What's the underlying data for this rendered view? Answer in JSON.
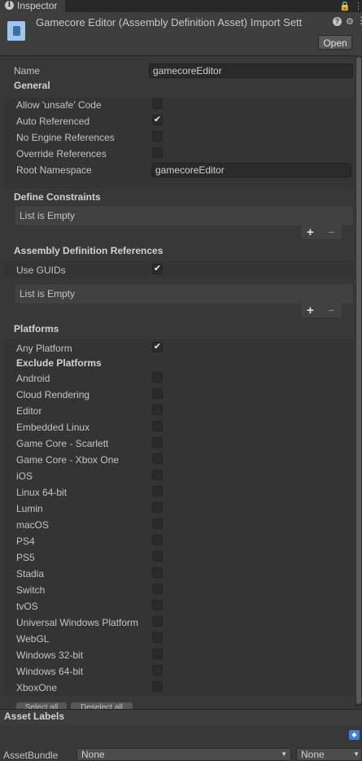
{
  "tab": {
    "label": "Inspector"
  },
  "header": {
    "title": "Gamecore Editor (Assembly Definition Asset) Import Sett",
    "open_label": "Open"
  },
  "name": {
    "label": "Name",
    "value": "gamecoreEditor"
  },
  "general": {
    "heading": "General",
    "allow_unsafe": {
      "label": "Allow 'unsafe' Code",
      "checked": false
    },
    "auto_referenced": {
      "label": "Auto Referenced",
      "checked": true
    },
    "no_engine_refs": {
      "label": "No Engine References",
      "checked": false
    },
    "override_refs": {
      "label": "Override References",
      "checked": false
    },
    "root_namespace": {
      "label": "Root Namespace",
      "value": "gamecoreEditor"
    }
  },
  "define_constraints": {
    "heading": "Define Constraints",
    "empty_text": "List is Empty",
    "add": "+",
    "remove": "−"
  },
  "assembly_refs": {
    "heading": "Assembly Definition References",
    "use_guids": {
      "label": "Use GUIDs",
      "checked": true
    },
    "empty_text": "List is Empty",
    "add": "+",
    "remove": "−"
  },
  "platforms": {
    "heading": "Platforms",
    "any_platform": {
      "label": "Any Platform",
      "checked": true
    },
    "exclude_heading": "Exclude Platforms",
    "items": [
      {
        "label": "Android",
        "checked": false
      },
      {
        "label": "Cloud Rendering",
        "checked": false
      },
      {
        "label": "Editor",
        "checked": false
      },
      {
        "label": "Embedded Linux",
        "checked": false
      },
      {
        "label": "Game Core - Scarlett",
        "checked": false
      },
      {
        "label": "Game Core - Xbox One",
        "checked": false
      },
      {
        "label": "iOS",
        "checked": false
      },
      {
        "label": "Linux 64-bit",
        "checked": false
      },
      {
        "label": "Lumin",
        "checked": false
      },
      {
        "label": "macOS",
        "checked": false
      },
      {
        "label": "PS4",
        "checked": false
      },
      {
        "label": "PS5",
        "checked": false
      },
      {
        "label": "Stadia",
        "checked": false
      },
      {
        "label": "Switch",
        "checked": false
      },
      {
        "label": "tvOS",
        "checked": false
      },
      {
        "label": "Universal Windows Platform",
        "checked": false
      },
      {
        "label": "WebGL",
        "checked": false
      },
      {
        "label": "Windows 32-bit",
        "checked": false
      },
      {
        "label": "Windows 64-bit",
        "checked": false
      },
      {
        "label": "XboxOne",
        "checked": false
      }
    ],
    "select_all": "Select all",
    "deselect_all": "Deselect all"
  },
  "asset_labels": {
    "heading": "Asset Labels"
  },
  "asset_bundle": {
    "label": "AssetBundle",
    "bundle_value": "None",
    "variant_value": "None"
  },
  "checkmark": "✔"
}
